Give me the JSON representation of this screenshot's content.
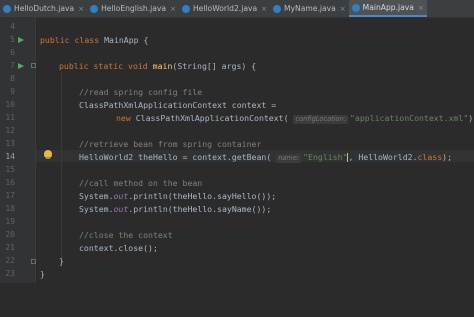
{
  "tabs": [
    {
      "label": "HelloDutch.java",
      "active": false
    },
    {
      "label": "HelloEnglish.java",
      "active": false
    },
    {
      "label": "HelloWorld2.java",
      "active": false
    },
    {
      "label": "MyName.java",
      "active": false
    },
    {
      "label": "MainApp.java",
      "active": true
    }
  ],
  "tab_close_glyph": "×",
  "line_numbers": [
    "4",
    "5",
    "6",
    "7",
    "8",
    "9",
    "10",
    "11",
    "12",
    "13",
    "14",
    "15",
    "16",
    "17",
    "18",
    "19",
    "20",
    "21",
    "22",
    "23",
    "24",
    "25"
  ],
  "current_line": "14",
  "code": {
    "l5": {
      "kw": "public class ",
      "txt": "MainApp {"
    },
    "l7": {
      "kw": "public static void ",
      "fn": "main",
      "txt": "(String[] args) {"
    },
    "l9": {
      "cm": "//read spring config file"
    },
    "l10": {
      "txt": "ClassPathXmlApplicationContext context ="
    },
    "l11": {
      "kw": "new ",
      "txt": "ClassPathXmlApplicationContext(",
      "hint": "configLocation:",
      "str": "\"applicationContext.xml\"",
      "end": ");"
    },
    "l13": {
      "cm": "//retrieve bean from spring container"
    },
    "l14": {
      "txt": "HelloWorld2 theHello = context.getBean(",
      "hint": "name:",
      "str": "\"English\"",
      "mid": ", HelloWorld2.",
      "kw": "class",
      "end": ");"
    },
    "l16": {
      "cm": "//call method on the bean"
    },
    "l17": {
      "a": "System.",
      "it": "out",
      "b": ".println(theHello.sayHello());"
    },
    "l18": {
      "a": "System.",
      "it": "out",
      "b": ".println(theHello.sayName());"
    },
    "l20": {
      "cm": "//close the context"
    },
    "l21": {
      "txt": "context.close();"
    },
    "l22": {
      "txt": "}"
    },
    "l23": {
      "txt": "}"
    }
  },
  "colors": {
    "keyword": "#cc7832",
    "string": "#6a8759",
    "comment": "#808080",
    "method": "#ffc66d",
    "static_field": "#9876aa",
    "text": "#a9b7c6",
    "background": "#2b2b2b"
  },
  "icons": {
    "run": "run-arrow-icon",
    "bulb": "intention-bulb-icon",
    "tab_file": "java-class-icon"
  }
}
